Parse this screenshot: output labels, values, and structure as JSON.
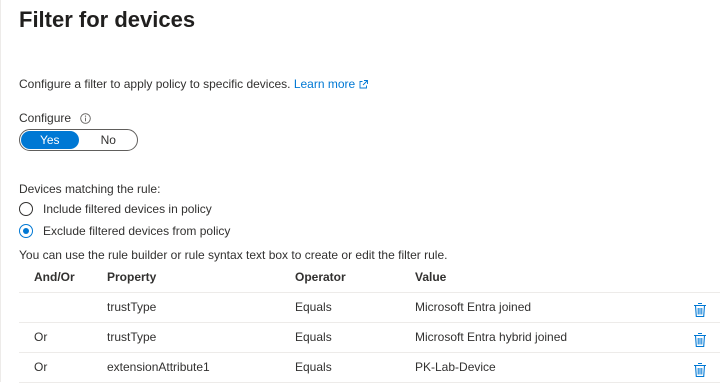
{
  "header": {
    "title": "Filter for devices"
  },
  "description": {
    "text": "Configure a filter to apply policy to specific devices. ",
    "link_label": "Learn more"
  },
  "configure": {
    "label": "Configure",
    "options": [
      "Yes",
      "No"
    ],
    "selected": "Yes"
  },
  "matching": {
    "label": "Devices matching the rule:",
    "options": [
      {
        "label": "Include filtered devices in policy",
        "checked": false
      },
      {
        "label": "Exclude filtered devices from policy",
        "checked": true
      }
    ]
  },
  "helper_text": "You can use the rule builder or rule syntax text box to create or edit the filter rule.",
  "table": {
    "columns": [
      "And/Or",
      "Property",
      "Operator",
      "Value"
    ],
    "rows": [
      {
        "andor": "",
        "property": "trustType",
        "operator": "Equals",
        "value": "Microsoft Entra joined"
      },
      {
        "andor": "Or",
        "property": "trustType",
        "operator": "Equals",
        "value": "Microsoft Entra hybrid joined"
      },
      {
        "andor": "Or",
        "property": "extensionAttribute1",
        "operator": "Equals",
        "value": "PK-Lab-Device"
      }
    ]
  },
  "icons": {
    "external": "external-link-icon",
    "info": "info-icon",
    "delete": "trash-icon"
  },
  "colors": {
    "accent": "#0078d4",
    "text": "#323130",
    "divider": "#edebe9"
  }
}
